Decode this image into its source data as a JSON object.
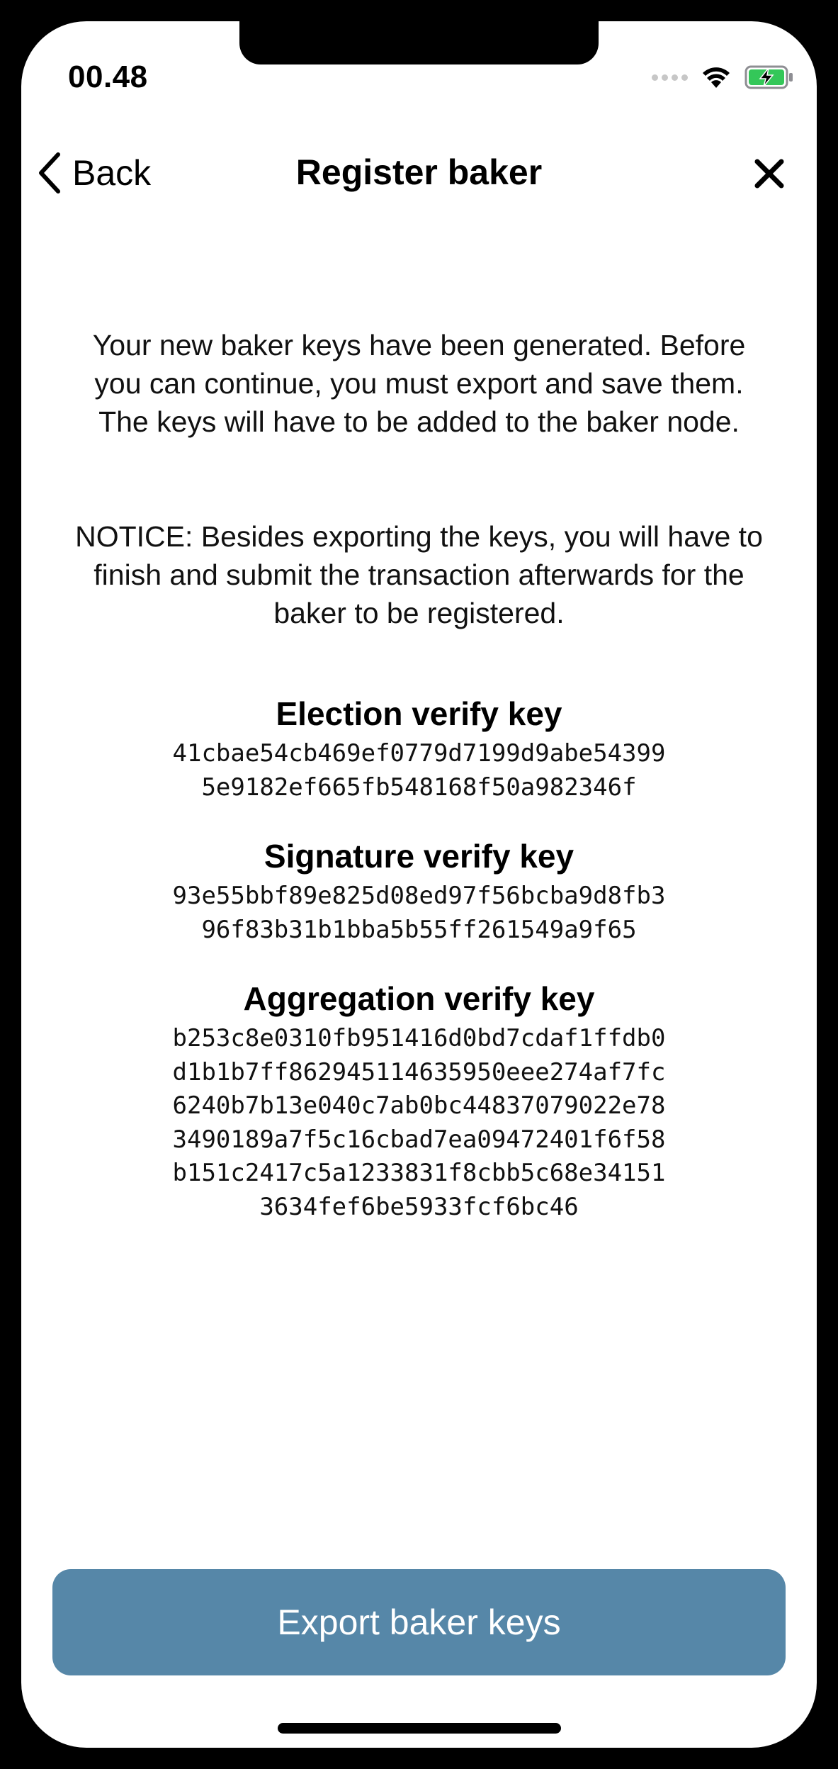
{
  "status_bar": {
    "time": "00.48"
  },
  "nav": {
    "back_label": "Back",
    "title": "Register baker"
  },
  "content": {
    "intro": "Your new baker keys have been generated. Before you can continue, you must export and save them. The keys will have to be added to the baker node.",
    "notice": "NOTICE: Besides exporting the keys, you will have to finish and submit the transaction afterwards for the baker to be registered.",
    "keys": [
      {
        "heading": "Election verify key",
        "value": "41cbae54cb469ef0779d7199d9abe543995e9182ef665fb548168f50a982346f"
      },
      {
        "heading": "Signature verify key",
        "value": "93e55bbf89e825d08ed97f56bcba9d8fb396f83b31b1bba5b55ff261549a9f65"
      },
      {
        "heading": "Aggregation verify key",
        "value": "b253c8e0310fb951416d0bd7cdaf1ffdb0d1b1b7ff862945114635950eee274af7fc6240b7b13e040c7ab0bc44837079022e783490189a7f5c16cbad7ea09472401f6f58b151c2417c5a1233831f8cbb5c68e341513634fef6be5933fcf6bc46"
      }
    ]
  },
  "actions": {
    "export_label": "Export baker keys"
  },
  "colors": {
    "accent": "#5687a8",
    "battery_green": "#34c759"
  }
}
